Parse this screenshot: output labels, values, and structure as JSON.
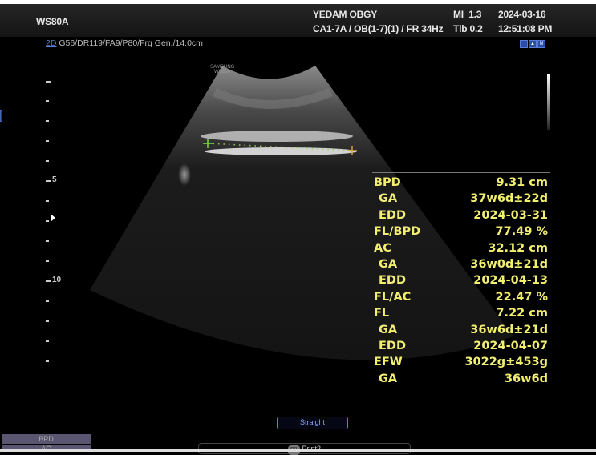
{
  "header": {
    "device": "WS80A",
    "institution": "YEDAM OBGY",
    "probe_info": "CA1-7A / OB(1-7)(1) / FR 34Hz",
    "mi": "MI  1.3",
    "tib": "Tlb 0.2",
    "date": "2024-03-16",
    "time": "12:51:08 PM"
  },
  "params": {
    "mode": "2D",
    "settings": " G56/DR119/FA9/P80/Frq Gen./14.0cm"
  },
  "icons": [
    "hq-icon",
    "probe-icon",
    "m-icon"
  ],
  "image_logo": {
    "line1": "SAMSUNG",
    "line2": "WS80A"
  },
  "depth_scale": {
    "labels": [
      "5",
      "10"
    ]
  },
  "measurements": [
    {
      "label": "BPD",
      "value": "9.31 cm",
      "sub": false
    },
    {
      "label": "GA",
      "value": "37w6d±22d",
      "sub": true
    },
    {
      "label": "EDD",
      "value": "2024-03-31",
      "sub": true
    },
    {
      "label": "FL/BPD",
      "value": "77.49 %",
      "sub": false
    },
    {
      "label": "AC",
      "value": "32.12 cm",
      "sub": false
    },
    {
      "label": "GA",
      "value": "36w0d±21d",
      "sub": true
    },
    {
      "label": "EDD",
      "value": "2024-04-13",
      "sub": true
    },
    {
      "label": "FL/AC",
      "value": "22.47 %",
      "sub": false
    },
    {
      "label": "FL",
      "value": "7.22 cm",
      "sub": false
    },
    {
      "label": "GA",
      "value": "36w6d±21d",
      "sub": true
    },
    {
      "label": "EDD",
      "value": "2024-04-07",
      "sub": true
    },
    {
      "label": "EFW",
      "value": "3022g±453g",
      "sub": false
    },
    {
      "label": "GA",
      "value": "36w6d",
      "sub": true
    }
  ],
  "controls": {
    "straight": "Straight",
    "bpd": "BPD",
    "ac": "AC",
    "print_badge": "P2",
    "print": "Print2"
  },
  "colors": {
    "measure_text": "#f1ee70",
    "accent": "#5b7bd8"
  }
}
